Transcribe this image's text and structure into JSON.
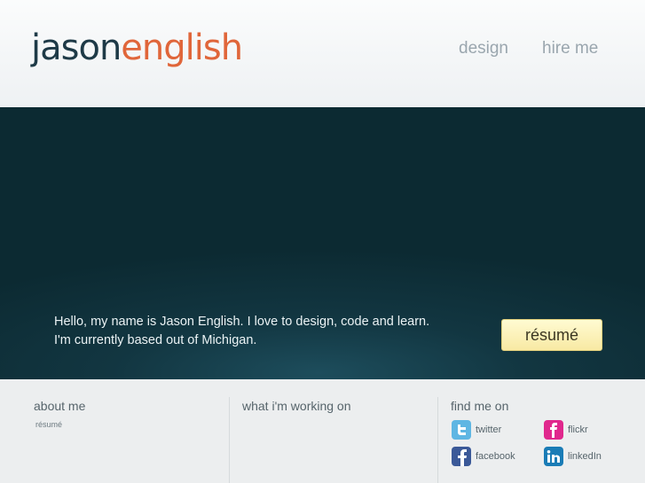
{
  "header": {
    "logo_first": "jason",
    "logo_last": "english",
    "nav": {
      "design": "design",
      "hire_me": "hire me"
    }
  },
  "hero": {
    "line1": "Hello, my name is Jason English. I love to design, code and learn.",
    "line2": "I'm currently based out of Michigan.",
    "resume_button": "résumé"
  },
  "footer": {
    "about": {
      "title": "about me",
      "resume_link": "résumé"
    },
    "working": {
      "title": "what i'm working on"
    },
    "find": {
      "title": "find me on",
      "social": [
        {
          "label": "twitter",
          "icon": "twitter-icon",
          "color": "#5fb6e3"
        },
        {
          "label": "flickr",
          "icon": "flickr-icon",
          "color": "#e0288d"
        },
        {
          "label": "facebook",
          "icon": "facebook-icon",
          "color": "#3b5998"
        },
        {
          "label": "linkedIn",
          "icon": "linkedin-icon",
          "color": "#1a7cb6"
        }
      ]
    }
  },
  "colors": {
    "logo_dark": "#1e3a47",
    "logo_accent": "#e0663a",
    "hero_bg": "#0c2a32",
    "button_bg": "#fbf1b8"
  }
}
